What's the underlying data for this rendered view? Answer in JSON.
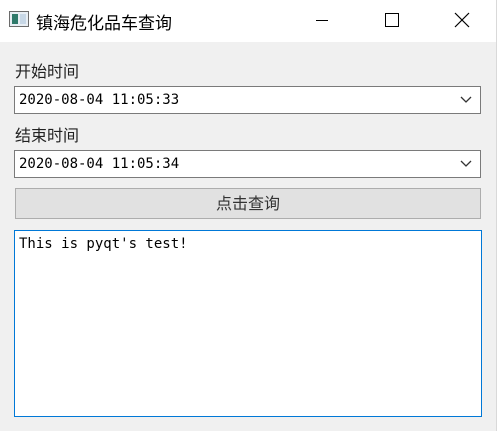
{
  "window": {
    "title": "镇海危化品车查询",
    "icons": {
      "app": "window-app-icon",
      "minimize": "minimize-icon",
      "maximize": "maximize-icon",
      "close": "close-icon"
    }
  },
  "form": {
    "start_label": "开始时间",
    "start_value": "2020-08-04 11:05:33",
    "end_label": "结束时间",
    "end_value": "2020-08-04 11:05:34",
    "query_button": "点击查询",
    "output_text": "This is pyqt's test!"
  },
  "colors": {
    "window_bg": "#f0f0f0",
    "titlebar_bg": "#ffffff",
    "focus_border": "#0078d7",
    "button_bg": "#e1e1e1"
  }
}
